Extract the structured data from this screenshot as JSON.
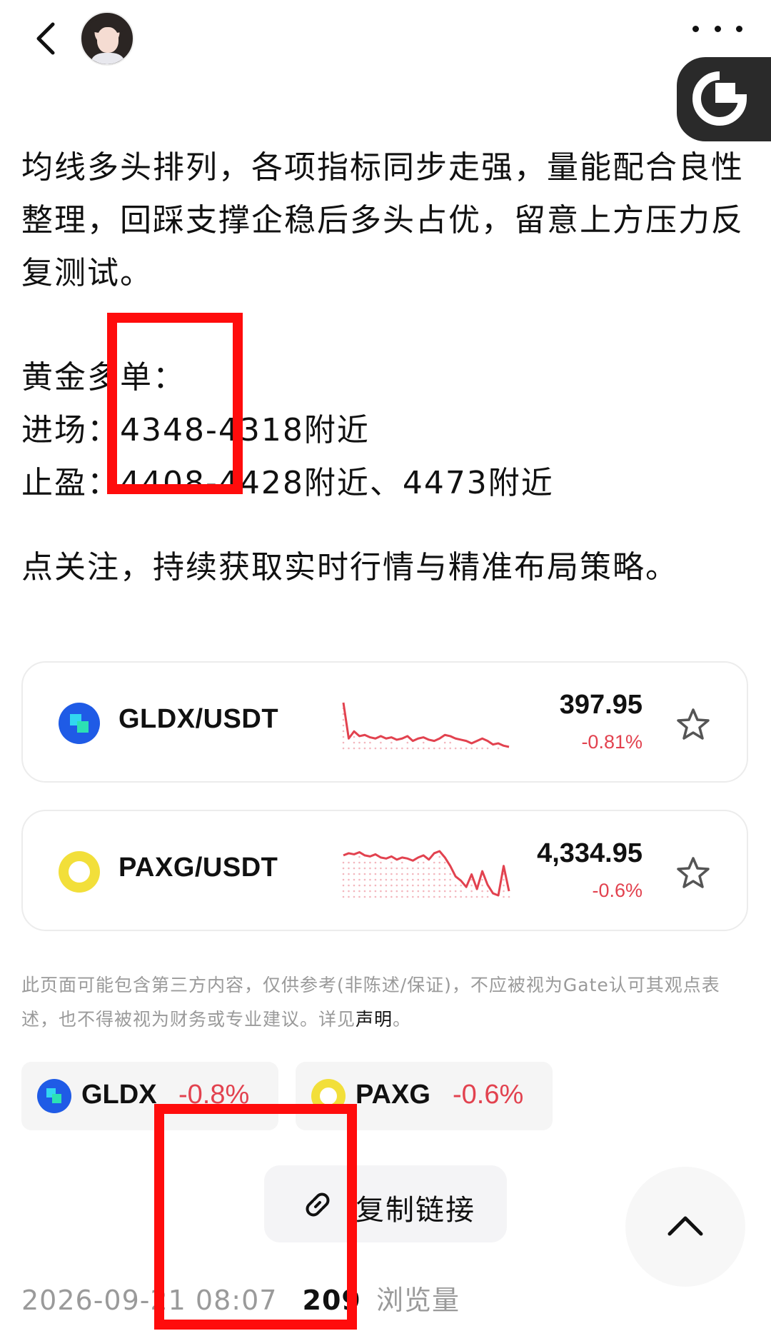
{
  "header": {
    "back_icon": "chevron-left-icon",
    "more_icon": "more-dots-icon",
    "brand_icon": "gate-logo-icon"
  },
  "article": {
    "para1": "均线多头排列，各项指标同步走强，量能配合良性整理，回踩支撑企稳后多头占优，留意上方压力反复测试。",
    "line_title": "黄金多单：",
    "line_entry": "进场：4348-4318附近",
    "line_tp": "止盈：4408-4428附近、4473附近",
    "para3": "点关注，持续获取实时行情与精准布局策略。"
  },
  "cards": [
    {
      "pair": "GLDX/USDT",
      "price": "397.95",
      "change": "-0.81%",
      "icon": "gldx-coin-icon",
      "spark": [
        100,
        70,
        76,
        72,
        73,
        71,
        70,
        72,
        70,
        71,
        69,
        70,
        72,
        68,
        70,
        71,
        69,
        68,
        70,
        73,
        72,
        70,
        69,
        68,
        66,
        68,
        70,
        68,
        65,
        66,
        64,
        63
      ]
    },
    {
      "pair": "PAXG/USDT",
      "price": "4,334.95",
      "change": "-0.6%",
      "icon": "paxg-coin-icon",
      "spark": [
        90,
        92,
        91,
        93,
        90,
        89,
        91,
        88,
        87,
        89,
        86,
        88,
        87,
        85,
        88,
        90,
        86,
        92,
        94,
        88,
        80,
        70,
        66,
        60,
        72,
        58,
        75,
        62,
        54,
        52,
        80,
        56
      ]
    }
  ],
  "disclaimer": {
    "text": "此页面可能包含第三方内容，仅供参考(非陈述/保证)，不应被视为Gate认可其观点表述，也不得被视为财务或专业建议。详见",
    "link": "声明",
    "end": "。"
  },
  "tags": [
    {
      "name": "GLDX",
      "change": "-0.8%"
    },
    {
      "name": "PAXG",
      "change": "-0.6%"
    }
  ],
  "actions": {
    "copy_link": "复制链接",
    "copy_icon": "link-icon",
    "scroll_top_icon": "chevron-up-icon"
  },
  "meta": {
    "datetime": "2026-09-21 08:07",
    "views": "209",
    "views_label": "浏览量"
  },
  "colors": {
    "down": "#e2424f",
    "annotation": "#ff0c0c",
    "gldx": "#1f5be6",
    "paxg": "#f2df3a"
  }
}
